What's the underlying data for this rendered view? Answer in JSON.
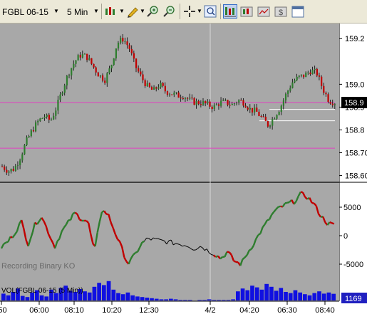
{
  "toolbar": {
    "instrument": "FGBL 06-15",
    "interval": "5 Min",
    "icons": [
      "add-instrument-icon",
      "candle-style-icon",
      "draw-tool-icon",
      "zoom-in-icon",
      "zoom-out-icon",
      "crosshair-icon",
      "magnifier-icon",
      "chart-trader-icon",
      "bar-type-icon",
      "line-chart-icon",
      "dollar-icon",
      "properties-icon"
    ]
  },
  "watermark": "Recording Binary KO",
  "volume_label": "VOL(FGBL 06-15 (5 Min))",
  "price_axis": {
    "ticks": [
      "159.2",
      "159.0",
      "158.9",
      "158.8",
      "158.70",
      "158.60"
    ],
    "last_price": "158.9"
  },
  "indicator_axis": {
    "ticks": [
      "5000",
      "0",
      "-5000"
    ]
  },
  "volume_axis": {
    "last_value": "1169"
  },
  "time_axis": {
    "ticks": [
      ":50",
      "06:00",
      "08:10",
      "10:20",
      "12:30",
      "4/2",
      "04:20",
      "06:30",
      "08:40"
    ]
  },
  "colors": {
    "panel_bg": "#a8a8a8",
    "up_candle": "#2e7d2e",
    "down_candle": "#c00000",
    "volume_bar": "#1010e0",
    "magenta_line": "#e040c0",
    "white_line": "#ffffff",
    "price_tag_bg": "#000000",
    "volume_tag_bg": "#2020c0"
  },
  "chart_data": {
    "type": "candlestick",
    "series": [
      {
        "name": "FGBL 06-15",
        "close_path": [
          158.64,
          158.62,
          158.63,
          158.68,
          158.75,
          158.8,
          158.84,
          158.86,
          158.84,
          158.9,
          158.98,
          159.05,
          159.1,
          159.13,
          159.12,
          159.08,
          159.04,
          159.02,
          159.08,
          159.18,
          159.2,
          159.16,
          159.08,
          159.03,
          158.99,
          158.97,
          159.0,
          158.97,
          158.96,
          158.95,
          158.95,
          158.93,
          158.92,
          158.92,
          158.91,
          158.9,
          158.92,
          158.92,
          158.91,
          158.93,
          158.92,
          158.89,
          158.88,
          158.85,
          158.82,
          158.86,
          158.9,
          158.96,
          159.01,
          159.03,
          159.04,
          159.06,
          159.05,
          158.98,
          158.93,
          158.92
        ]
      },
      {
        "name": "Oscillator",
        "values": [
          -2000,
          -1000,
          500,
          2500,
          -1500,
          1800,
          3500,
          800,
          -2000,
          600,
          2200,
          4000,
          3000,
          2500,
          -3000,
          4500,
          3800,
          800,
          -2000,
          -5000,
          -3500,
          -1500,
          -500,
          -700,
          -900,
          -1100,
          -1300,
          -1500,
          -1700,
          -2300,
          -1800,
          -2600,
          -3200,
          -4000,
          -2800,
          -4500,
          -5000,
          -3000,
          -1200,
          800,
          2500,
          4200,
          5000,
          5600,
          6000,
          7300,
          6800,
          5500,
          3500,
          2200,
          1800
        ]
      },
      {
        "name": "VOL(FGBL 06-15 (5 Min))",
        "values": [
          1200,
          900,
          1500,
          2100,
          800,
          600,
          1400,
          1800,
          900,
          700,
          1900,
          1300,
          2200,
          2600,
          1700,
          1500,
          2000,
          1600,
          1400,
          2400,
          3100,
          2700,
          3400,
          1900,
          1300,
          1100,
          1400,
          900,
          700,
          600,
          500,
          400,
          300,
          200,
          200,
          300,
          200,
          100,
          100,
          100,
          0,
          100,
          100,
          200,
          100,
          100,
          100,
          100,
          200,
          1600,
          2100,
          1800,
          2600,
          2300,
          1900,
          2900,
          2400,
          1700,
          2200,
          1500,
          1300,
          1800,
          1400,
          1100,
          900,
          1300,
          1600,
          1200,
          1400,
          1169
        ]
      }
    ],
    "horizontal_lines": [
      158.92,
      158.72,
      158.89,
      158.84
    ],
    "price_range": [
      158.58,
      159.26
    ],
    "indicator_range": [
      -7500,
      9000
    ]
  }
}
